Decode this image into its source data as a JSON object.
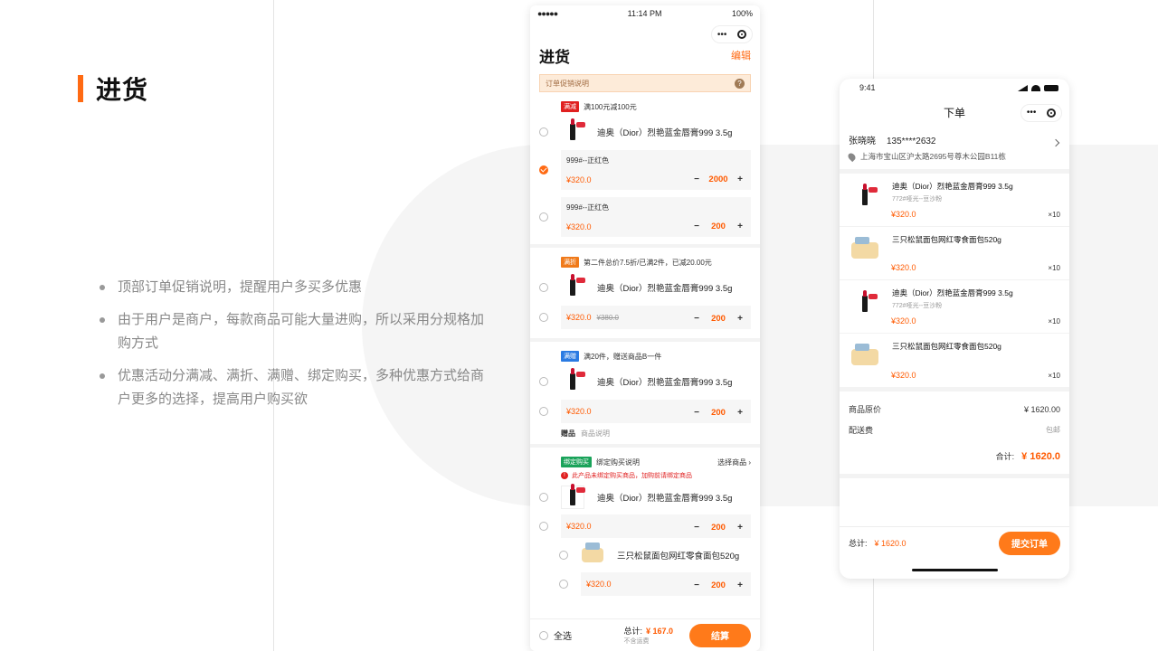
{
  "slide": {
    "title": "进货",
    "bullets": [
      "顶部订单促销说明，提醒用户多买多优惠",
      "由于用户是商户，每款商品可能大量进购，所以采用分规格加购方式",
      "优惠活动分满减、满折、满赠、绑定购买，多种优惠方式给商户更多的选择，提高用户购买欲"
    ]
  },
  "colors": {
    "accent": "#ff6a13",
    "price": "#ff5a00"
  },
  "phone1": {
    "status": {
      "signal": "●●●●●",
      "time": "11:14 PM",
      "battery": "100%"
    },
    "capsule": {
      "menu": "•••"
    },
    "title": "进货",
    "edit": "编辑",
    "promo_note": "订单促销说明",
    "promo_icon": "?",
    "sections": [
      {
        "tag": "满减",
        "tag_color": "#e02020",
        "promo": "满100元减100元",
        "product": "迪奥（Dior）烈艳蓝金唇膏999 3.5g",
        "specs": [
          {
            "name": "999#--正红色",
            "price": "¥320.0",
            "qty": "2000",
            "checked": true
          },
          {
            "name": "999#--正红色",
            "price": "¥320.0",
            "qty": "200",
            "checked": false
          }
        ]
      },
      {
        "tag": "满折",
        "tag_color": "#f07a1a",
        "promo": "第二件总价7.5折/已满2件，已减20.00元",
        "product": "迪奥（Dior）烈艳蓝金唇膏999 3.5g",
        "specs": [
          {
            "price": "¥320.0",
            "old_price": "¥380.0",
            "qty": "200"
          }
        ]
      },
      {
        "tag": "满赠",
        "tag_color": "#2a7ae2",
        "promo": "满20件，赠送商品B一件",
        "product": "迪奥（Dior）烈艳蓝金唇膏999 3.5g",
        "specs": [
          {
            "price": "¥320.0",
            "qty": "200"
          }
        ],
        "gift_label": "赠品",
        "gift_note": "商品说明"
      },
      {
        "tag": "绑定购买",
        "tag_color": "#1aa35a",
        "promo": "绑定购买说明",
        "select_label": "选择商品",
        "warning": "此产品未绑定购买商品，加购前请绑定商品",
        "warning_icon": "!",
        "product": "迪奥（Dior）烈艳蓝金唇膏999 3.5g",
        "specs": [
          {
            "price": "¥320.0",
            "qty": "200"
          }
        ],
        "product2": "三只松鼠面包网红零食面包520g",
        "specs2": [
          {
            "price": "¥320.0",
            "qty": "200"
          }
        ]
      }
    ],
    "stepper": {
      "minus": "−",
      "plus": "+"
    },
    "footer": {
      "select_all": "全选",
      "total_label": "总计:",
      "total": "¥ 167.0",
      "shipping": "不含运费",
      "checkout": "结算"
    }
  },
  "phone2": {
    "status": {
      "time": "9:41"
    },
    "capsule": {
      "menu": "•••"
    },
    "title": "下单",
    "address": {
      "name": "张晓晓",
      "phone": "135****2632",
      "addr": "上海市宝山区沪太路2695号尊木公园B11栋"
    },
    "items": [
      {
        "kind": "lip",
        "name": "迪奥（Dior）烈艳蓝金唇膏999 3.5g",
        "spec": "772#哑光--豆沙粉",
        "price": "¥320.0",
        "qty": "×10"
      },
      {
        "kind": "bread",
        "name": "三只松鼠面包网红零食面包520g",
        "spec": "",
        "price": "¥320.0",
        "qty": "×10"
      },
      {
        "kind": "lip",
        "name": "迪奥（Dior）烈艳蓝金唇膏999 3.5g",
        "spec": "772#哑光--豆沙粉",
        "price": "¥320.0",
        "qty": "×10"
      },
      {
        "kind": "bread",
        "name": "三只松鼠面包网红零食面包520g",
        "spec": "",
        "price": "¥320.0",
        "qty": "×10"
      }
    ],
    "summary": {
      "orig_label": "商品原价",
      "orig": "¥ 1620.00",
      "ship_label": "配送费",
      "ship": "包邮",
      "total_label": "合计:",
      "total": "¥ 1620.0"
    },
    "footer": {
      "total_label": "总计:",
      "total": "¥ 1620.0",
      "submit": "提交订单"
    }
  }
}
